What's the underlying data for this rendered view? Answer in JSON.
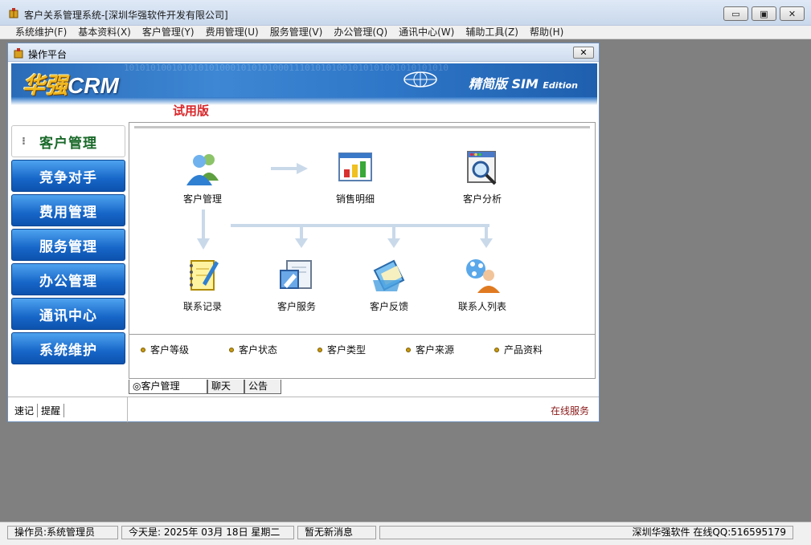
{
  "window": {
    "title": "客户关系管理系统-[深圳华强软件开发有限公司]",
    "minimize_symbol": "▭",
    "maximize_symbol": "▣",
    "close_symbol": "✕"
  },
  "menu": [
    "系统维护(F)",
    "基本资料(X)",
    "客户管理(Y)",
    "费用管理(U)",
    "服务管理(V)",
    "办公管理(Q)",
    "通讯中心(W)",
    "辅助工具(Z)",
    "帮助(H)"
  ],
  "child": {
    "title": "操作平台",
    "close_symbol": "✕"
  },
  "banner": {
    "binary": "1010101001010101010001010101000111010101001010101001010101010",
    "logo_cn": "华强",
    "logo_en": "CRM",
    "edition_cn": "精简版",
    "edition_en": "SIM",
    "edition_sub": "Edition",
    "trial": "试用版"
  },
  "nav": {
    "dots": "⁝",
    "items": [
      "客户管理",
      "竞争对手",
      "费用管理",
      "服务管理",
      "办公管理",
      "通讯中心",
      "系统维护"
    ],
    "active_index": 0
  },
  "flow": {
    "top": [
      "客户管理",
      "销售明细",
      "客户分析"
    ],
    "bottom": [
      "联系记录",
      "客户服务",
      "客户反馈",
      "联系人列表"
    ]
  },
  "bullets": [
    "客户等级",
    "客户状态",
    "客户类型",
    "客户来源",
    "产品资料"
  ],
  "tabs": [
    "◎客户管理",
    "聊天",
    "公告"
  ],
  "quick_links": [
    "速记",
    "提醒"
  ],
  "online_service": "在线服务",
  "status": {
    "operator": "操作员:系统管理员",
    "today": "今天是: 2025年 03月 18日   星期二",
    "messages": "暂无新消息",
    "contact": "深圳华强软件 在线QQ:516595179"
  },
  "colors": {
    "nav_blue": "#1666c8",
    "trial_red": "#d8262a",
    "online_red": "#8a1818",
    "arrow_blue": "#c9d9ea"
  }
}
